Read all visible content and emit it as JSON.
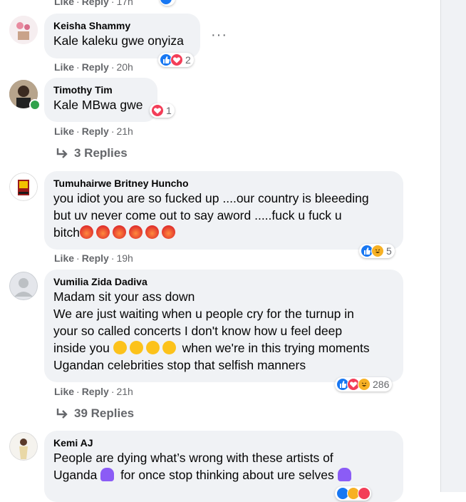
{
  "top_actions": {
    "like": "Like",
    "reply": "Reply",
    "time": "17h"
  },
  "comments": [
    {
      "name": "Keisha Shammy",
      "lines": [
        "Kale kaleku gwe onyiza"
      ],
      "time": "20h",
      "reaction_count": "2",
      "reactions": [
        "like",
        "love"
      ]
    },
    {
      "name": "Timothy Tim",
      "lines": [
        "Kale MBwa gwe"
      ],
      "time": "21h",
      "reaction_count": "1",
      "reactions": [
        "love"
      ],
      "replies_label": "3 Replies"
    },
    {
      "name": "Tumuhairwe Britney Huncho",
      "lines": [
        "you idiot you are so fucked up ....our country is bleeeding",
        "but uv never come out to say aword .....fuck u fuck u",
        "bitch"
      ],
      "time": "19h",
      "reaction_count": "5",
      "reactions": [
        "like",
        "haha"
      ]
    },
    {
      "name": "Vumilia Zida Dadiva",
      "lines": [
        "Madam sit your ass down",
        "We are just waiting when u people cry for the turnup in",
        "your so called concerts I don't know how u feel deep",
        "inside you",
        "when we're in this trying moments",
        "Ugandan celebrities stop that selfish manners"
      ],
      "time": "21h",
      "reaction_count": "286",
      "reactions": [
        "like",
        "love",
        "haha"
      ],
      "replies_label": "39 Replies"
    },
    {
      "name": "Kemi AJ",
      "lines": [
        "People are dying what’s wrong with these artists of",
        "Uganda",
        "for once stop thinking about ure selves"
      ]
    }
  ],
  "labels": {
    "like": "Like",
    "reply": "Reply"
  },
  "colors": {
    "bubble": "#f0f2f5",
    "meta": "#65676b",
    "like": "#1877f2",
    "love": "#f33e58",
    "haha": "#f7b125",
    "online": "#31a24c"
  }
}
